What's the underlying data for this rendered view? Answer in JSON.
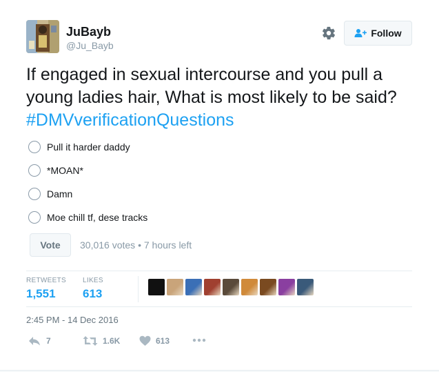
{
  "user": {
    "name": "JuBayb",
    "handle": "@Ju_Bayb",
    "avatar_icon": "profile-photo"
  },
  "header": {
    "follow_label": "Follow",
    "settings_icon": "gear-icon"
  },
  "tweet": {
    "text": "If engaged in sexual intercourse and you pull a young ladies hair, What is most likely to be said?",
    "hashtag": "#DMVverificationQuestions"
  },
  "poll": {
    "options": [
      "Pull it harder daddy",
      "*MOAN*",
      "Damn",
      "Moe chill tf, dese tracks"
    ],
    "vote_label": "Vote",
    "votes": "30,016 votes",
    "time_left": "7 hours left",
    "separator": "•"
  },
  "stats": {
    "retweets_label": "RETWEETS",
    "retweets_count": "1,551",
    "likes_label": "LIKES",
    "likes_count": "613"
  },
  "likers": [
    "#111111",
    "#c9a47a",
    "#3b6fb6",
    "#a04030",
    "#5a4a3a",
    "#d08a3a",
    "#7a4a20",
    "#8a3fa0",
    "#3a5a7a"
  ],
  "timestamp": "2:45 PM - 14 Dec 2016",
  "actions": {
    "reply_count": "7",
    "retweet_count": "1.6K",
    "like_count": "613",
    "more_icon": "more-icon"
  },
  "colors": {
    "link_blue": "#1da1f2",
    "muted": "#8899a6",
    "icon_grey": "#aab8c2"
  }
}
